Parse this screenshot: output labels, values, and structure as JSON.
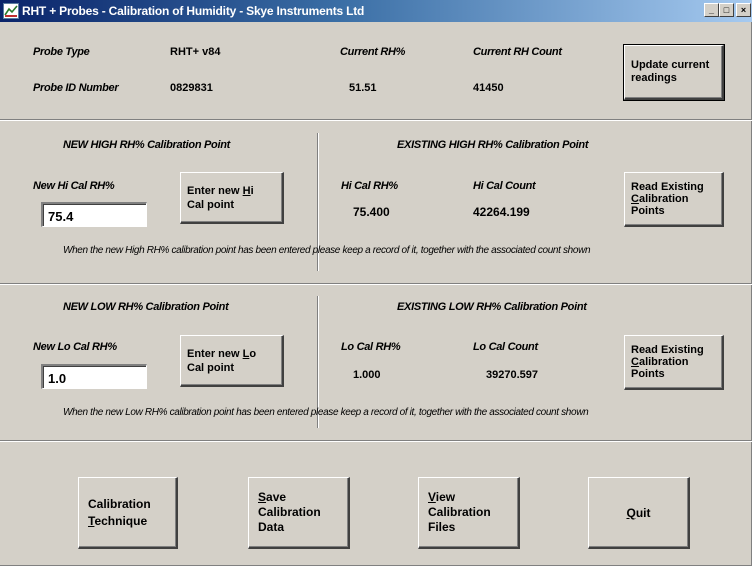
{
  "window": {
    "title": "RHT + Probes - Calibration of Humidity - Skye Instruments Ltd",
    "minimize_label": "_",
    "maximize_label": "□",
    "close_label": "×"
  },
  "header": {
    "probe_type_label": "Probe Type",
    "probe_type_value": "RHT+ v84",
    "probe_id_label": "Probe ID Number",
    "probe_id_value": "0829831",
    "current_rh_label": "Current RH%",
    "current_rh_value": "51.51",
    "current_count_label": "Current RH Count",
    "current_count_value": "41450",
    "update_button": {
      "line1": "Update current",
      "line2": "readings"
    }
  },
  "high": {
    "new_title": "NEW HIGH RH% Calibration Point",
    "new_label": "New Hi Cal RH%",
    "new_value": "75.4",
    "enter_button": {
      "pre": "Enter new ",
      "key": "H",
      "post": "i",
      "line2": "Cal point"
    },
    "existing_title": "EXISTING HIGH RH% Calibration Point",
    "cal_rh_label": "Hi Cal RH%",
    "cal_rh_value": "75.400",
    "cal_count_label": "Hi Cal Count",
    "cal_count_value": "42264.199",
    "read_button": {
      "line1": "Read Existing",
      "line2_key": "C",
      "line2_rest": "alibration",
      "line3": "Points"
    },
    "note": "When the new High RH% calibration point has been entered please keep a record of it, together with the associated count shown"
  },
  "low": {
    "new_title": "NEW LOW RH% Calibration Point",
    "new_label": "New Lo Cal RH%",
    "new_value": "1.0",
    "enter_button": {
      "pre": "Enter new ",
      "key": "L",
      "post": "o",
      "line2": "Cal point"
    },
    "existing_title": "EXISTING LOW RH% Calibration Point",
    "cal_rh_label": "Lo Cal RH%",
    "cal_rh_value": "1.000",
    "cal_count_label": "Lo Cal Count",
    "cal_count_value": "39270.597",
    "read_button": {
      "line1": "Read Existing",
      "line2_key": "C",
      "line2_rest": "alibration",
      "line3": "Points"
    },
    "note": "When the new Low RH% calibration point has been entered please keep a record of it, together with the associated count shown"
  },
  "footer": {
    "technique_button": {
      "line1": "Calibration",
      "line2_key": "T",
      "line2_rest": "echnique"
    },
    "save_button": {
      "line1_key": "S",
      "line1_rest": "ave",
      "line2": "Calibration",
      "line3": "Data"
    },
    "view_button": {
      "line1_key": "V",
      "line1_rest": "iew",
      "line2": "Calibration",
      "line3": "Files"
    },
    "quit_button": {
      "key": "Q",
      "rest": "uit"
    }
  }
}
